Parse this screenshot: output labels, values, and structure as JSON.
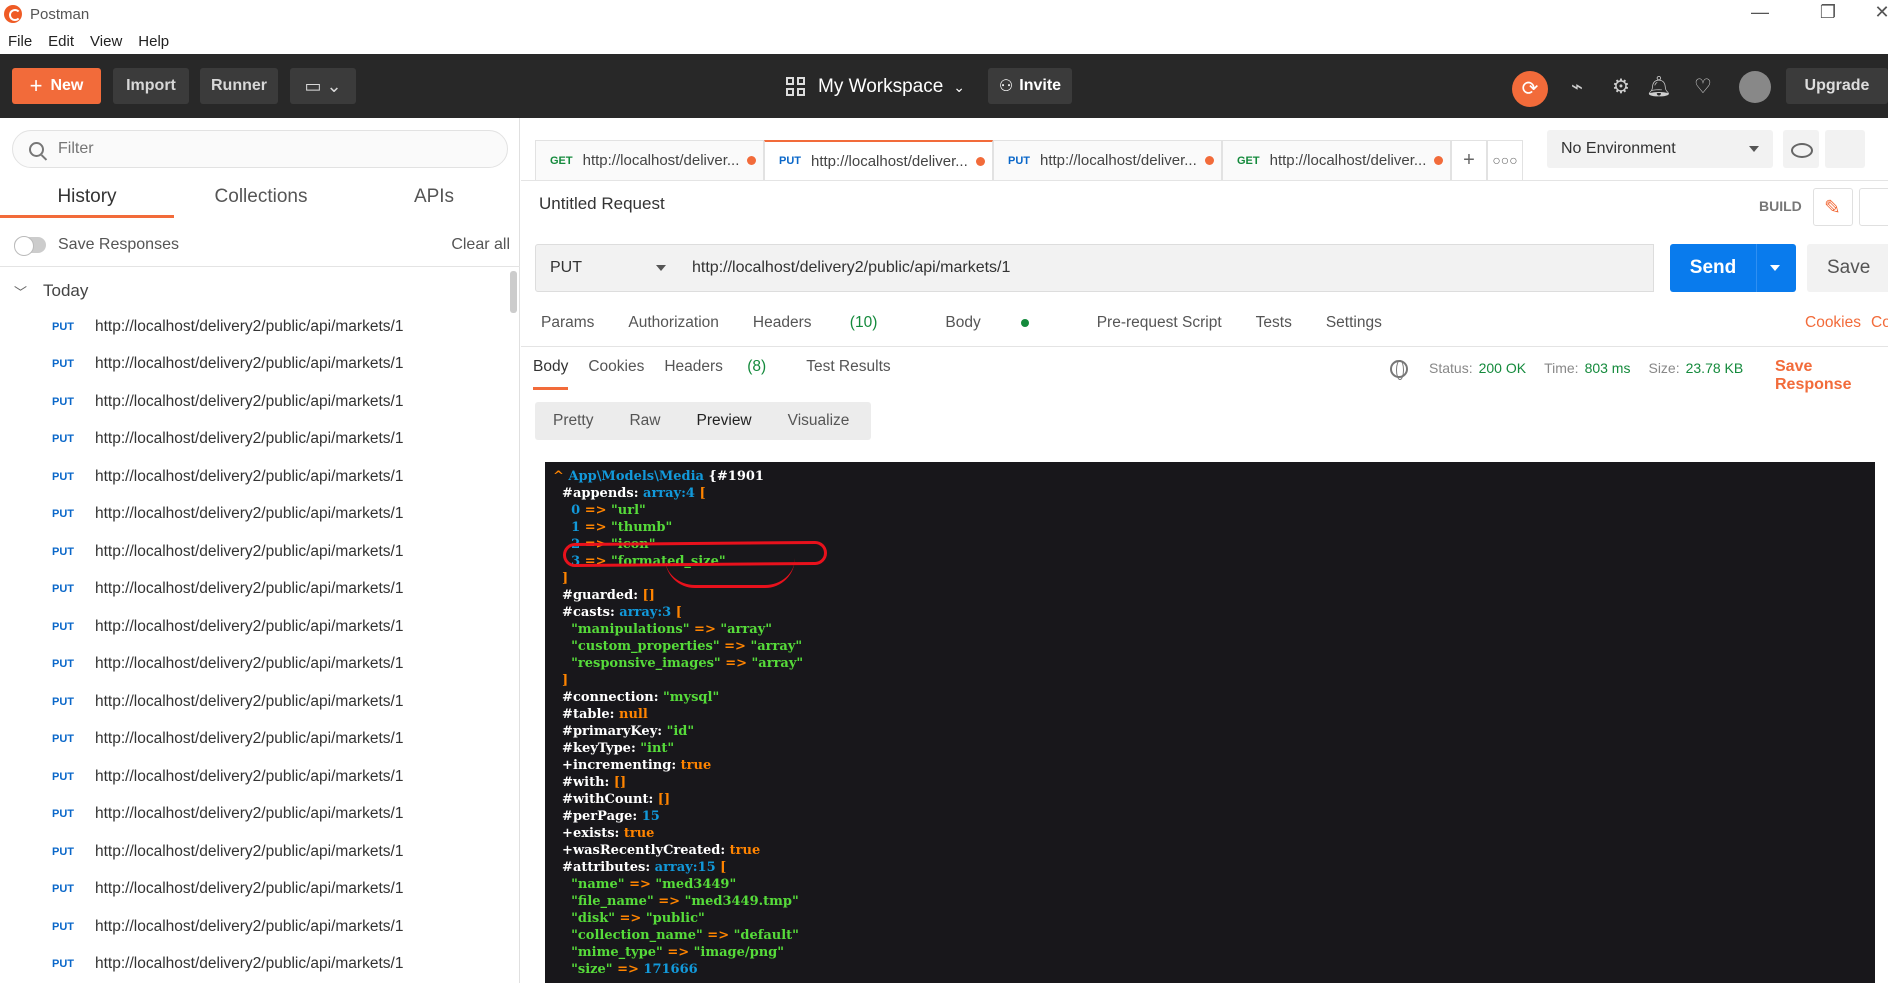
{
  "window": {
    "title": "Postman"
  },
  "menu": [
    "File",
    "Edit",
    "View",
    "Help"
  ],
  "toolbar": {
    "new_label": "New",
    "import_label": "Import",
    "runner_label": "Runner",
    "workspace": "My Workspace",
    "invite_label": "Invite",
    "upgrade_label": "Upgrade"
  },
  "sidebar": {
    "filter_placeholder": "Filter",
    "tabs": [
      "History",
      "Collections",
      "APIs"
    ],
    "active_tab": "History",
    "save_responses_label": "Save Responses",
    "clear_all_label": "Clear all",
    "group_label": "Today",
    "history": [
      {
        "method": "PUT",
        "url": "http://localhost/delivery2/public/api/markets/1"
      },
      {
        "method": "PUT",
        "url": "http://localhost/delivery2/public/api/markets/1"
      },
      {
        "method": "PUT",
        "url": "http://localhost/delivery2/public/api/markets/1"
      },
      {
        "method": "PUT",
        "url": "http://localhost/delivery2/public/api/markets/1"
      },
      {
        "method": "PUT",
        "url": "http://localhost/delivery2/public/api/markets/1"
      },
      {
        "method": "PUT",
        "url": "http://localhost/delivery2/public/api/markets/1"
      },
      {
        "method": "PUT",
        "url": "http://localhost/delivery2/public/api/markets/1"
      },
      {
        "method": "PUT",
        "url": "http://localhost/delivery2/public/api/markets/1"
      },
      {
        "method": "PUT",
        "url": "http://localhost/delivery2/public/api/markets/1"
      },
      {
        "method": "PUT",
        "url": "http://localhost/delivery2/public/api/markets/1"
      },
      {
        "method": "PUT",
        "url": "http://localhost/delivery2/public/api/markets/1"
      },
      {
        "method": "PUT",
        "url": "http://localhost/delivery2/public/api/markets/1"
      },
      {
        "method": "PUT",
        "url": "http://localhost/delivery2/public/api/markets/1"
      },
      {
        "method": "PUT",
        "url": "http://localhost/delivery2/public/api/markets/1"
      },
      {
        "method": "PUT",
        "url": "http://localhost/delivery2/public/api/markets/1"
      },
      {
        "method": "PUT",
        "url": "http://localhost/delivery2/public/api/markets/1"
      },
      {
        "method": "PUT",
        "url": "http://localhost/delivery2/public/api/markets/1"
      },
      {
        "method": "PUT",
        "url": "http://localhost/delivery2/public/api/markets/1"
      }
    ]
  },
  "request_tabs": [
    {
      "method": "GET",
      "label": "http://localhost/deliver...",
      "active": false
    },
    {
      "method": "PUT",
      "label": "http://localhost/deliver...",
      "active": true
    },
    {
      "method": "PUT",
      "label": "http://localhost/deliver...",
      "active": false
    },
    {
      "method": "GET",
      "label": "http://localhost/deliver...",
      "active": false
    }
  ],
  "environment": "No Environment",
  "request": {
    "name": "Untitled Request",
    "build_label": "BUILD",
    "method": "PUT",
    "url": "http://localhost/delivery2/public/api/markets/1",
    "send_label": "Send",
    "save_label": "Save",
    "subtabs": {
      "params": "Params",
      "authorization": "Authorization",
      "headers": "Headers",
      "headers_count": "(10)",
      "body": "Body",
      "prerequest": "Pre-request Script",
      "tests": "Tests",
      "settings": "Settings"
    },
    "cookies_link": "Cookies",
    "codes_link": "Co"
  },
  "response": {
    "tabs": {
      "body": "Body",
      "cookies": "Cookies",
      "headers": "Headers",
      "headers_count": "(8)",
      "test_results": "Test Results"
    },
    "status_label": "Status:",
    "status": "200 OK",
    "time_label": "Time:",
    "time": "803 ms",
    "size_label": "Size:",
    "size": "23.78 KB",
    "save_response": "Save Response",
    "views": [
      "Pretty",
      "Raw",
      "Preview",
      "Visualize"
    ],
    "active_view": "Preview"
  },
  "code_lines": [
    [
      [
        "o",
        "^ "
      ],
      [
        "n",
        "App\\Models\\Media "
      ],
      [
        "k",
        "{#1901"
      ]
    ],
    [
      [
        "k",
        "  #appends"
      ],
      [
        "k",
        ": "
      ],
      [
        "n",
        "array:4 "
      ],
      [
        "o",
        "["
      ]
    ],
    [
      [
        "n",
        "    0 "
      ],
      [
        "o",
        "=> "
      ],
      [
        "s",
        "\"url\""
      ]
    ],
    [
      [
        "n",
        "    1 "
      ],
      [
        "o",
        "=> "
      ],
      [
        "s",
        "\"thumb\""
      ]
    ],
    [
      [
        "n",
        "    2 "
      ],
      [
        "o",
        "=> "
      ],
      [
        "s",
        "\"icon\""
      ]
    ],
    [
      [
        "n",
        "    3 "
      ],
      [
        "o",
        "=> "
      ],
      [
        "s",
        "\"formated_size\""
      ]
    ],
    [
      [
        "o",
        "  ]"
      ]
    ],
    [
      [
        "k",
        "  #guarded"
      ],
      [
        "k",
        ": "
      ],
      [
        "o",
        "[]"
      ]
    ],
    [
      [
        "k",
        "  #casts"
      ],
      [
        "k",
        ": "
      ],
      [
        "n",
        "array:3 "
      ],
      [
        "o",
        "["
      ]
    ],
    [
      [
        "s",
        "    \"manipulations\" "
      ],
      [
        "o",
        "=> "
      ],
      [
        "s",
        "\"array\""
      ]
    ],
    [
      [
        "s",
        "    \"custom_properties\" "
      ],
      [
        "o",
        "=> "
      ],
      [
        "s",
        "\"array\""
      ]
    ],
    [
      [
        "s",
        "    \"responsive_images\" "
      ],
      [
        "o",
        "=> "
      ],
      [
        "s",
        "\"array\""
      ]
    ],
    [
      [
        "o",
        "  ]"
      ]
    ],
    [
      [
        "k",
        "  #connection"
      ],
      [
        "k",
        ": "
      ],
      [
        "s",
        "\"mysql\""
      ]
    ],
    [
      [
        "k",
        "  #table"
      ],
      [
        "k",
        ": "
      ],
      [
        "o",
        "null"
      ]
    ],
    [
      [
        "k",
        "  #primaryKey"
      ],
      [
        "k",
        ": "
      ],
      [
        "s",
        "\"id\""
      ]
    ],
    [
      [
        "k",
        "  #keyType"
      ],
      [
        "k",
        ": "
      ],
      [
        "s",
        "\"int\""
      ]
    ],
    [
      [
        "k",
        "  +incrementing"
      ],
      [
        "k",
        ": "
      ],
      [
        "o",
        "true"
      ]
    ],
    [
      [
        "k",
        "  #with"
      ],
      [
        "k",
        ": "
      ],
      [
        "o",
        "[]"
      ]
    ],
    [
      [
        "k",
        "  #withCount"
      ],
      [
        "k",
        ": "
      ],
      [
        "o",
        "[]"
      ]
    ],
    [
      [
        "k",
        "  #perPage"
      ],
      [
        "k",
        ": "
      ],
      [
        "n",
        "15"
      ]
    ],
    [
      [
        "k",
        "  +exists"
      ],
      [
        "k",
        ": "
      ],
      [
        "o",
        "true"
      ]
    ],
    [
      [
        "k",
        "  +wasRecentlyCreated"
      ],
      [
        "k",
        ": "
      ],
      [
        "o",
        "true"
      ]
    ],
    [
      [
        "k",
        "  #attributes"
      ],
      [
        "k",
        ": "
      ],
      [
        "n",
        "array:15 "
      ],
      [
        "o",
        "["
      ]
    ],
    [
      [
        "s",
        "    \"name\" "
      ],
      [
        "o",
        "=> "
      ],
      [
        "s",
        "\"med3449\""
      ]
    ],
    [
      [
        "s",
        "    \"file_name\" "
      ],
      [
        "o",
        "=> "
      ],
      [
        "s",
        "\"med3449.tmp\""
      ]
    ],
    [
      [
        "s",
        "    \"disk\" "
      ],
      [
        "o",
        "=> "
      ],
      [
        "s",
        "\"public\""
      ]
    ],
    [
      [
        "s",
        "    \"collection_name\" "
      ],
      [
        "o",
        "=> "
      ],
      [
        "s",
        "\"default\""
      ]
    ],
    [
      [
        "s",
        "    \"mime_type\" "
      ],
      [
        "o",
        "=> "
      ],
      [
        "s",
        "\"image/png\""
      ]
    ],
    [
      [
        "s",
        "    \"size\" "
      ],
      [
        "o",
        "=> "
      ],
      [
        "n",
        "171666"
      ]
    ]
  ],
  "colors": {
    "accent": "#f26b3a",
    "send": "#097bed",
    "toolbar_bg": "#282828",
    "code_bg": "#18171b",
    "annotation": "#e8111c"
  }
}
